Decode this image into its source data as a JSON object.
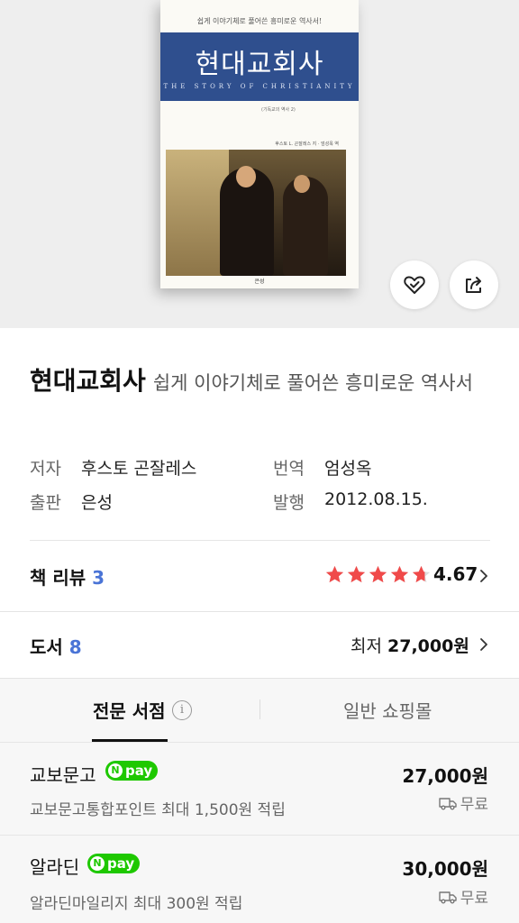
{
  "cover": {
    "tagline": "쉽게 이야기체로 풀어쓴 흥미로운 역사서!",
    "title": "현대교회사",
    "subtitle": "THE STORY OF CHRISTIANITY",
    "small_line": "(기독교의 역사 2)",
    "author_line": "후스토 L. 곤잘레스 지 · 엄성옥 역",
    "publisher": "은성"
  },
  "book": {
    "title": "현대교회사",
    "subtitle": "쉽게 이야기체로 풀어쓴 흥미로운 역사서"
  },
  "meta": {
    "author_label": "저자",
    "author": "후스토 곤잘레스",
    "translator_label": "번역",
    "translator": "엄성옥",
    "publisher_label": "출판",
    "publisher": "은성",
    "date_label": "발행",
    "date": "2012.08.15."
  },
  "review": {
    "label": "책 리뷰",
    "count": "3",
    "rating": "4.67",
    "stars": 4.67
  },
  "books": {
    "label": "도서",
    "count": "8",
    "lowest_label": "최저",
    "lowest_price": "27,000원"
  },
  "tabs": {
    "active": "전문 서점",
    "inactive": "일반 쇼핑몰",
    "info_icon": "i"
  },
  "stores": [
    {
      "name": "교보문고",
      "npay": "pay",
      "points": "교보문고통합포인트 최대 1,500원 적립",
      "price": "27,000원",
      "shipping": "무료"
    },
    {
      "name": "알라딘",
      "npay": "pay",
      "points": "알라딘마일리지 최대 300원 적립",
      "price": "30,000원",
      "shipping": "무료"
    }
  ],
  "colors": {
    "accent_count": "#4a74d6",
    "star": "#f04a4a",
    "npay": "#1ec800",
    "cover_band": "#2f4f8e"
  },
  "icons": {
    "like": "heart-check-icon",
    "share": "share-icon",
    "chevron": "chevron-right-icon",
    "shipping": "truck-icon",
    "info": "info-icon"
  }
}
